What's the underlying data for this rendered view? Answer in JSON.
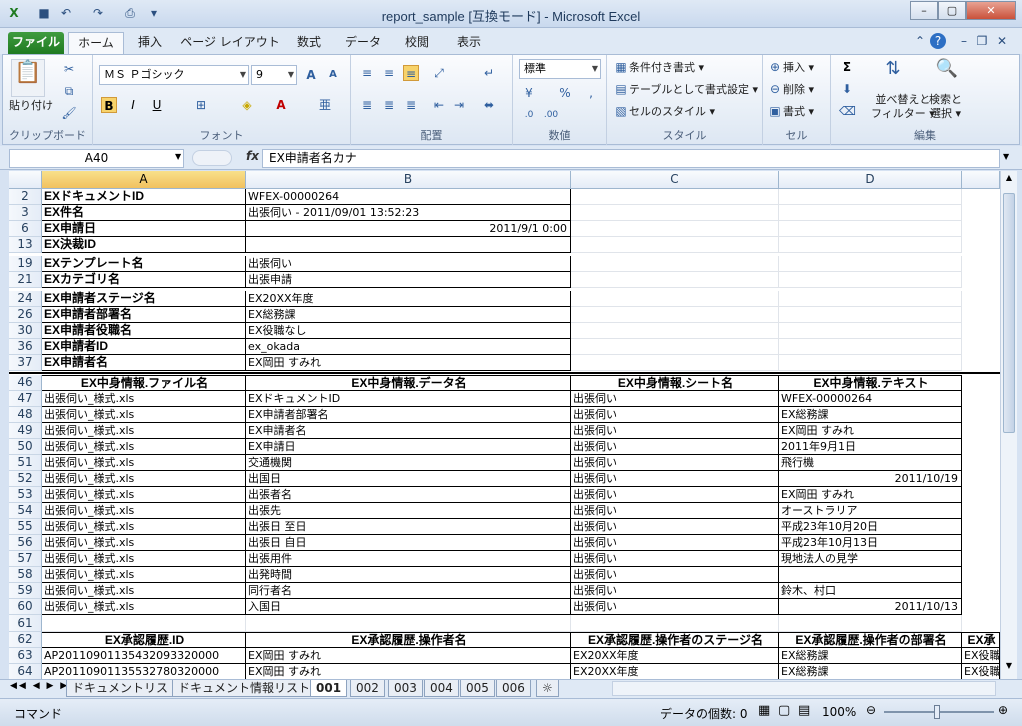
{
  "window": {
    "title": "report_sample [互換モード] - Microsoft Excel"
  },
  "tabs": [
    "ファイル",
    "ホーム",
    "挿入",
    "ページ レイアウト",
    "数式",
    "データ",
    "校閲",
    "表示"
  ],
  "ribbon": {
    "clipboard": {
      "label": "クリップボード",
      "paste": "貼り付け"
    },
    "font": {
      "label": "フォント",
      "name": "ＭＳ Ｐゴシック",
      "size": "9"
    },
    "align": {
      "label": "配置"
    },
    "number": {
      "label": "数値",
      "format": "標準"
    },
    "style": {
      "label": "スタイル",
      "cond": "条件付き書式",
      "table": "テーブルとして書式設定",
      "cellstyle": "セルのスタイル"
    },
    "cells": {
      "label": "セル",
      "insert": "挿入",
      "delete": "削除",
      "format": "書式"
    },
    "edit": {
      "label": "編集",
      "sort": "並べ替えと",
      "filter": "フィルター",
      "find": "検索と",
      "select": "選択"
    }
  },
  "formula": {
    "namebox": "A40",
    "fx": "fx",
    "value": "EX申請者名カナ"
  },
  "columns": [
    "A",
    "B",
    "C",
    "D",
    ""
  ],
  "rows": [
    {
      "n": "2",
      "cells": [
        "EXドキュメントID",
        "WFEX-00000264",
        "",
        ""
      ],
      "style": "kv"
    },
    {
      "n": "3",
      "cells": [
        "EX件名",
        "出張伺い - 2011/09/01 13:52:23",
        "",
        ""
      ],
      "style": "kv"
    },
    {
      "n": "6",
      "cells": [
        "EX申請日",
        "2011/9/1 0:00",
        "",
        ""
      ],
      "style": "kvr"
    },
    {
      "n": "13",
      "cells": [
        "EX決裁ID",
        "",
        "",
        ""
      ],
      "style": "kv"
    },
    {
      "n": "19",
      "cells": [
        "EXテンプレート名",
        "出張伺い",
        "",
        ""
      ],
      "style": "kv"
    },
    {
      "n": "21",
      "cells": [
        "EXカテゴリ名",
        "出張申請",
        "",
        ""
      ],
      "style": "kv"
    },
    {
      "n": "24",
      "cells": [
        "EX申請者ステージ名",
        "EX20XX年度",
        "",
        ""
      ],
      "style": "kv"
    },
    {
      "n": "26",
      "cells": [
        "EX申請者部署名",
        "EX総務課",
        "",
        ""
      ],
      "style": "kv"
    },
    {
      "n": "30",
      "cells": [
        "EX申請者役職名",
        "EX役職なし",
        "",
        ""
      ],
      "style": "kv"
    },
    {
      "n": "36",
      "cells": [
        "EX申請者ID",
        "ex_okada",
        "",
        ""
      ],
      "style": "kv"
    },
    {
      "n": "37",
      "cells": [
        "EX申請者名",
        "EX岡田 すみれ",
        "",
        ""
      ],
      "style": "kv"
    },
    {
      "n": "46",
      "cells": [
        "EX中身情報.ファイル名",
        "EX中身情報.データ名",
        "EX中身情報.シート名",
        "EX中身情報.テキスト"
      ],
      "style": "hdr"
    },
    {
      "n": "47",
      "cells": [
        "出張伺い_様式.xls",
        "EXドキュメントID",
        "出張伺い",
        "WFEX-00000264"
      ],
      "style": "t"
    },
    {
      "n": "48",
      "cells": [
        "出張伺い_様式.xls",
        "EX申請者部署名",
        "出張伺い",
        "EX総務課"
      ],
      "style": "t"
    },
    {
      "n": "49",
      "cells": [
        "出張伺い_様式.xls",
        "EX申請者名",
        "出張伺い",
        "EX岡田 すみれ"
      ],
      "style": "t"
    },
    {
      "n": "50",
      "cells": [
        "出張伺い_様式.xls",
        "EX申請日",
        "出張伺い",
        "2011年9月1日"
      ],
      "style": "t"
    },
    {
      "n": "51",
      "cells": [
        "出張伺い_様式.xls",
        "交通機関",
        "出張伺い",
        "飛行機"
      ],
      "style": "t"
    },
    {
      "n": "52",
      "cells": [
        "出張伺い_様式.xls",
        "出国日",
        "出張伺い",
        "2011/10/19"
      ],
      "style": "tr"
    },
    {
      "n": "53",
      "cells": [
        "出張伺い_様式.xls",
        "出張者名",
        "出張伺い",
        "EX岡田 すみれ"
      ],
      "style": "t"
    },
    {
      "n": "54",
      "cells": [
        "出張伺い_様式.xls",
        "出張先",
        "出張伺い",
        "オーストラリア"
      ],
      "style": "t"
    },
    {
      "n": "55",
      "cells": [
        "出張伺い_様式.xls",
        "出張日 至日",
        "出張伺い",
        "平成23年10月20日"
      ],
      "style": "t"
    },
    {
      "n": "56",
      "cells": [
        "出張伺い_様式.xls",
        "出張日 自日",
        "出張伺い",
        "平成23年10月13日"
      ],
      "style": "t"
    },
    {
      "n": "57",
      "cells": [
        "出張伺い_様式.xls",
        "出張用件",
        "出張伺い",
        "現地法人の見学"
      ],
      "style": "t"
    },
    {
      "n": "58",
      "cells": [
        "出張伺い_様式.xls",
        "出発時間",
        "出張伺い",
        ""
      ],
      "style": "t"
    },
    {
      "n": "59",
      "cells": [
        "出張伺い_様式.xls",
        "同行者名",
        "出張伺い",
        "鈴木、村口"
      ],
      "style": "t"
    },
    {
      "n": "60",
      "cells": [
        "出張伺い_様式.xls",
        "入国日",
        "出張伺い",
        "2011/10/13"
      ],
      "style": "tr"
    },
    {
      "n": "61",
      "cells": [
        "",
        "",
        "",
        ""
      ],
      "style": "e"
    },
    {
      "n": "62",
      "cells": [
        "EX承認履歴.ID",
        "EX承認履歴.操作者名",
        "EX承認履歴.操作者のステージ名",
        "EX承認履歴.操作者の部署名",
        "EX承"
      ],
      "style": "hdr"
    },
    {
      "n": "63",
      "cells": [
        "AP20110901135432093320000",
        "EX岡田 すみれ",
        "EX20XX年度",
        "EX総務課",
        "EX役職"
      ],
      "style": "t"
    },
    {
      "n": "64",
      "cells": [
        "AP20110901135532780320000",
        "EX岡田 すみれ",
        "EX20XX年度",
        "EX総務課",
        "EX役職"
      ],
      "style": "t"
    }
  ],
  "sheets": [
    "ドキュメントリスト",
    "ドキュメント情報リスト",
    "001",
    "002",
    "003",
    "004",
    "005",
    "006"
  ],
  "status": {
    "mode": "コマンド",
    "count": "データの個数: 0",
    "zoom": "100%"
  }
}
